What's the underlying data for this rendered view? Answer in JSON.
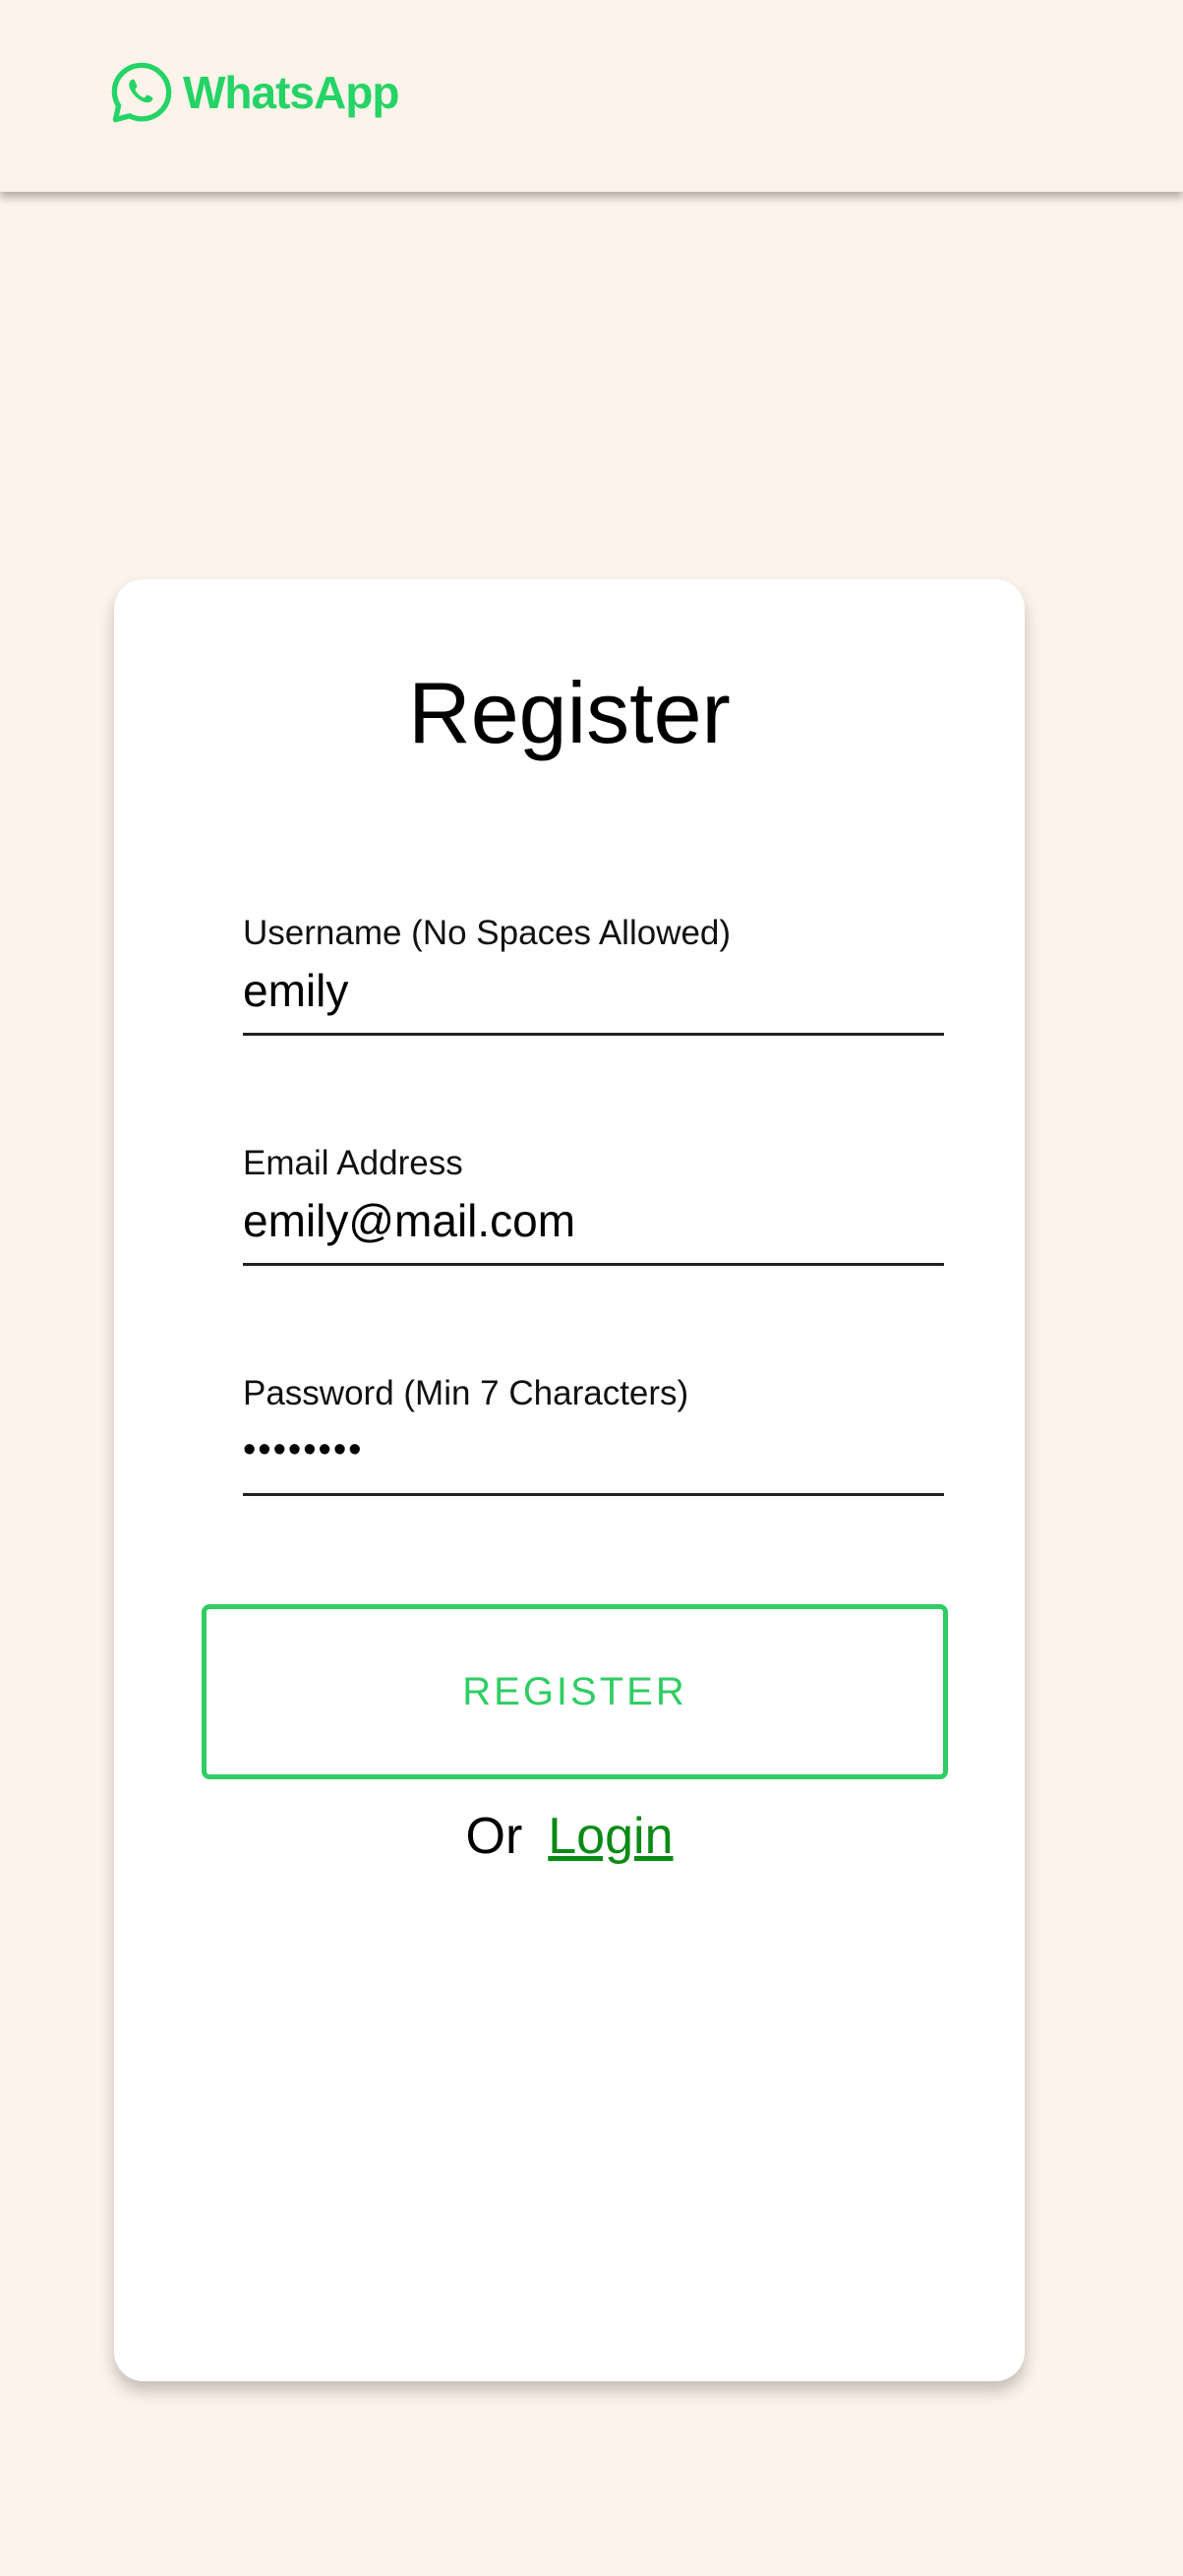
{
  "header": {
    "brand_name": "WhatsApp",
    "brand_icon": "whatsapp-logo-icon",
    "brand_color": "#25d366"
  },
  "form": {
    "title": "Register",
    "fields": [
      {
        "label": "Username (No Spaces Allowed)",
        "value": "emily",
        "type": "text"
      },
      {
        "label": "Email Address",
        "value": "emily@mail.com",
        "type": "email"
      },
      {
        "label": "Password (Min 7 Characters)",
        "value": "••••••••",
        "type": "password"
      }
    ],
    "submit_label": "REGISTER",
    "alt_prefix": "Or",
    "alt_link_label": "Login"
  },
  "colors": {
    "background": "#fcf3ea",
    "accent": "#2fcd63",
    "link": "#0a8a14"
  }
}
